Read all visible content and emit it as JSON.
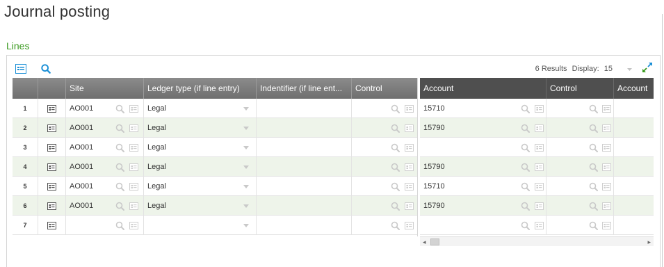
{
  "page": {
    "title": "Journal posting"
  },
  "section": {
    "label": "Lines"
  },
  "toolbar": {
    "results_label": "6 Results",
    "display_label": "Display:",
    "display_value": "15"
  },
  "colors": {
    "accent": "#3a9a1f",
    "icon_blue": "#1a8fd6",
    "header_light": "#7d7d7d",
    "header_dark": "#4f4f4f",
    "row_alt": "#eef4ea"
  },
  "grid": {
    "columns_left": [
      "",
      "",
      "Site",
      "Ledger type (if line entry)",
      "Indentifier (if line ent...",
      "Control"
    ],
    "columns_right": [
      "Account",
      "Control",
      "Account"
    ],
    "rows": [
      {
        "num": "1",
        "site": "AO001",
        "ledger": "Legal",
        "account": "15710"
      },
      {
        "num": "2",
        "site": "AO001",
        "ledger": "Legal",
        "account": "15790"
      },
      {
        "num": "3",
        "site": "AO001",
        "ledger": "Legal",
        "account": ""
      },
      {
        "num": "4",
        "site": "AO001",
        "ledger": "Legal",
        "account": "15790"
      },
      {
        "num": "5",
        "site": "AO001",
        "ledger": "Legal",
        "account": "15710"
      },
      {
        "num": "6",
        "site": "AO001",
        "ledger": "Legal",
        "account": "15790"
      },
      {
        "num": "7",
        "site": "",
        "ledger": "",
        "account": ""
      }
    ]
  },
  "icons": {
    "toolbar": [
      "detail-view-icon",
      "search-icon"
    ],
    "expand": "expand-icon",
    "row_detail": "row-detail-icon",
    "cell_search": "search-icon",
    "cell_select": "selection-icon",
    "dropdown": "chevron-down-icon",
    "scroll_left": "◂",
    "scroll_right": "▸"
  }
}
